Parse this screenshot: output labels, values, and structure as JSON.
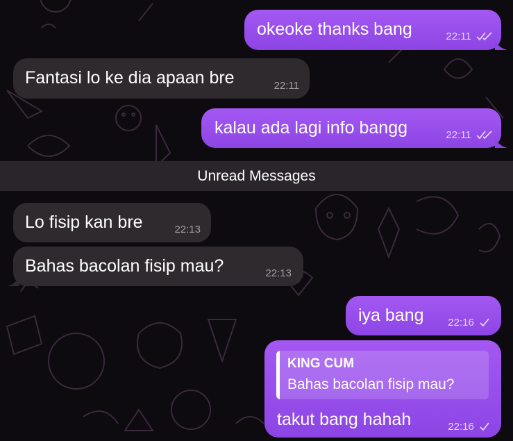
{
  "unread_divider": "Unread Messages",
  "messages": [
    {
      "text": "okeoke thanks bang",
      "time": "22:11",
      "direction": "outgoing",
      "status": "read"
    },
    {
      "text": "Fantasi lo ke dia apaan bre",
      "time": "22:11",
      "direction": "incoming"
    },
    {
      "text": "kalau ada lagi info bangg",
      "time": "22:11",
      "direction": "outgoing",
      "status": "read"
    },
    {
      "text": "Lo fisip kan bre",
      "time": "22:13",
      "direction": "incoming"
    },
    {
      "text": "Bahas bacolan fisip mau?",
      "time": "22:13",
      "direction": "incoming"
    },
    {
      "text": "iya bang",
      "time": "22:16",
      "direction": "outgoing",
      "status": "sent"
    },
    {
      "text": "takut bang hahah",
      "time": "22:16",
      "direction": "outgoing",
      "status": "sent",
      "reply": {
        "author": "KING CUM",
        "text": "Bahas bacolan fisip mau?"
      }
    }
  ],
  "colors": {
    "outgoing_bubble": "#9b51ec",
    "incoming_bubble": "#2f2a2e",
    "background": "#0d0a10",
    "unread_bar": "#29252a"
  },
  "icons": {
    "read": "double-check-icon",
    "sent": "single-check-icon"
  }
}
